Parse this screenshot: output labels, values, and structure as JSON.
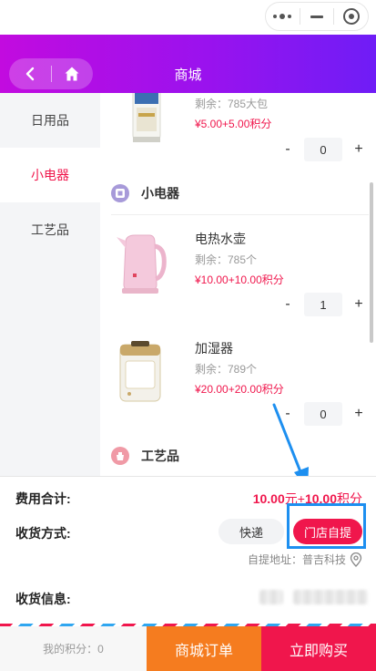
{
  "header": {
    "title": "商城"
  },
  "sidebar": {
    "items": [
      {
        "label": "日用品"
      },
      {
        "label": "小电器"
      },
      {
        "label": "工艺品"
      }
    ]
  },
  "products": {
    "partial": {
      "stock": "剩余：785大包",
      "price": "¥5.00+5.00积分",
      "qty": "0"
    },
    "appliances_title": "小电器",
    "kettle": {
      "name": "电热水壶",
      "stock": "剩余：785个",
      "price": "¥10.00+10.00积分",
      "qty": "1"
    },
    "humidifier": {
      "name": "加湿器",
      "stock": "剩余：789个",
      "price": "¥20.00+20.00积分",
      "qty": "0"
    },
    "crafts_title": "工艺品"
  },
  "stepper": {
    "minus": "-",
    "plus": "+"
  },
  "summary": {
    "fee_label": "费用合计:",
    "fee_amount": "10.00",
    "fee_unit": "元+",
    "fee_points": "10.00",
    "fee_points_unit": "积分",
    "delivery_label": "收货方式:",
    "delivery_option": "快递",
    "pickup_option": "门店自提",
    "pickup_address": "自提地址：普吉科技",
    "receiver_label": "收货信息:"
  },
  "bottom": {
    "points": "我的积分：0",
    "mall_order": "商城订单",
    "buy_now": "立即购买"
  },
  "colors": {
    "accent": "#f0164c",
    "header_gradient": [
      "#c20bdf",
      "#6f1df6"
    ],
    "mall_order_bg": "#f57c1f",
    "highlight_box": "#1d8ff0"
  },
  "icons": [
    "more-dots-icon",
    "minimize-icon",
    "close-target-icon",
    "back-icon",
    "home-icon",
    "appliance-category-icon",
    "craft-category-icon",
    "location-pin-icon"
  ]
}
